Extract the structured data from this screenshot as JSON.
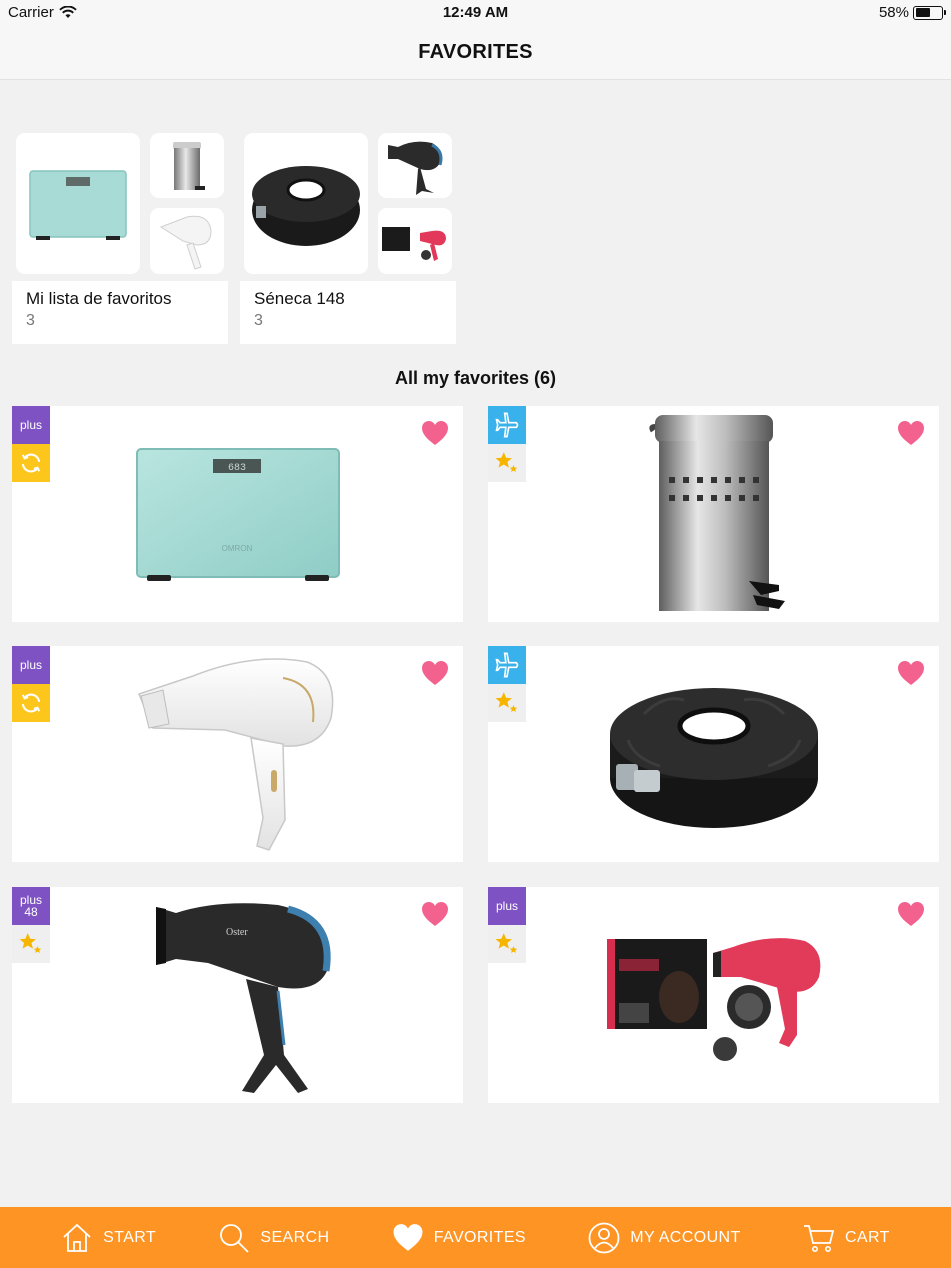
{
  "status": {
    "carrier": "Carrier",
    "time": "12:49 AM",
    "battery": "58%",
    "battery_level": 0.58
  },
  "nav": {
    "title": "FAVORITES"
  },
  "lists": [
    {
      "name": "Mi lista de favoritos",
      "count": "3"
    },
    {
      "name": "Séneca 148",
      "count": "3"
    }
  ],
  "section": {
    "title": "All my favorites (6)"
  },
  "products": [
    {
      "badge_top": "plus",
      "badge_bottom": "cycle-icon",
      "image": "bathroom-scale"
    },
    {
      "badge_top": "plane-icon",
      "badge_bottom": "star-icon",
      "image": "pedal-bin"
    },
    {
      "badge_top": "plus",
      "badge_bottom": "cycle-icon",
      "image": "white-hair-dryer"
    },
    {
      "badge_top": "plane-icon",
      "badge_bottom": "star-icon",
      "image": "bundt-cake-pan"
    },
    {
      "badge_top_line1": "plus",
      "badge_top_line2": "48",
      "badge_bottom": "star-icon",
      "image": "black-hair-dryer"
    },
    {
      "badge_top": "plus",
      "badge_bottom": "star-icon",
      "image": "pink-hair-dryer-set"
    }
  ],
  "tabs": [
    {
      "label": "START",
      "icon": "home-icon"
    },
    {
      "label": "SEARCH",
      "icon": "search-icon"
    },
    {
      "label": "FAVORITES",
      "icon": "heart-icon"
    },
    {
      "label": "MY ACCOUNT",
      "icon": "user-icon"
    },
    {
      "label": "CART",
      "icon": "cart-icon"
    }
  ],
  "colors": {
    "accent": "#fd9424",
    "heart": "#f3628f",
    "plus_badge": "#7e52c3",
    "plane_badge": "#39b2ec",
    "cycle_badge": "#fcc61c",
    "star": "#f6b600"
  }
}
